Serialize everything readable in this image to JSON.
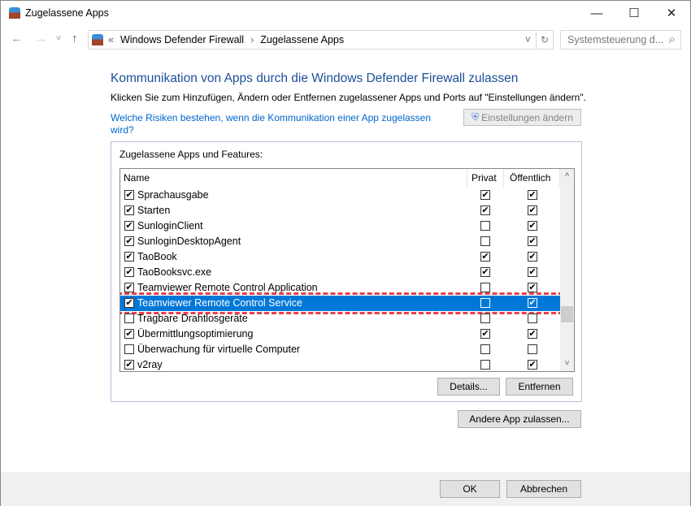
{
  "window": {
    "title": "Zugelassene Apps",
    "minimize": "—",
    "maximize": "☐",
    "close": "✕"
  },
  "nav": {
    "back": "←",
    "forward": "→",
    "recent": "˅",
    "up": "↑",
    "refresh": "↻",
    "dropdown": "˅"
  },
  "breadcrumb": {
    "overflow": "«",
    "items": [
      "Windows Defender Firewall",
      "Zugelassene Apps"
    ],
    "separator": "›"
  },
  "search": {
    "placeholder": "Systemsteuerung d...",
    "icon": "⌕"
  },
  "main": {
    "heading": "Kommunikation von Apps durch die Windows Defender Firewall zulassen",
    "subtext": "Klicken Sie zum Hinzufügen, Ändern oder Entfernen zugelassener Apps und Ports auf \"Einstellungen ändern\".",
    "risk_link": "Welche Risiken bestehen, wenn die Kommunikation einer App zugelassen wird?",
    "change_settings": "Einstellungen ändern",
    "group_label": "Zugelassene Apps und Features:",
    "columns": {
      "name": "Name",
      "private": "Privat",
      "public": "Öffentlich"
    },
    "rows": [
      {
        "name": "Sprachausgabe",
        "enabled": true,
        "private": true,
        "public": true
      },
      {
        "name": "Starten",
        "enabled": true,
        "private": true,
        "public": true
      },
      {
        "name": "SunloginClient",
        "enabled": true,
        "private": false,
        "public": true
      },
      {
        "name": "SunloginDesktopAgent",
        "enabled": true,
        "private": false,
        "public": true
      },
      {
        "name": "TaoBook",
        "enabled": true,
        "private": true,
        "public": true
      },
      {
        "name": "TaoBooksvc.exe",
        "enabled": true,
        "private": true,
        "public": true
      },
      {
        "name": "Teamviewer Remote Control Application",
        "enabled": true,
        "private": false,
        "public": true
      },
      {
        "name": "Teamviewer Remote Control Service",
        "enabled": true,
        "private": false,
        "public": true,
        "selected": true
      },
      {
        "name": "Tragbare Drahtlosgeräte",
        "enabled": false,
        "private": false,
        "public": false
      },
      {
        "name": "Übermittlungsoptimierung",
        "enabled": true,
        "private": true,
        "public": true
      },
      {
        "name": "Überwachung für virtuelle Computer",
        "enabled": false,
        "private": false,
        "public": false
      },
      {
        "name": "v2ray",
        "enabled": true,
        "private": false,
        "public": true
      }
    ],
    "details": "Details...",
    "remove": "Entfernen",
    "allow_other": "Andere App zulassen..."
  },
  "footer": {
    "ok": "OK",
    "cancel": "Abbrechen"
  }
}
